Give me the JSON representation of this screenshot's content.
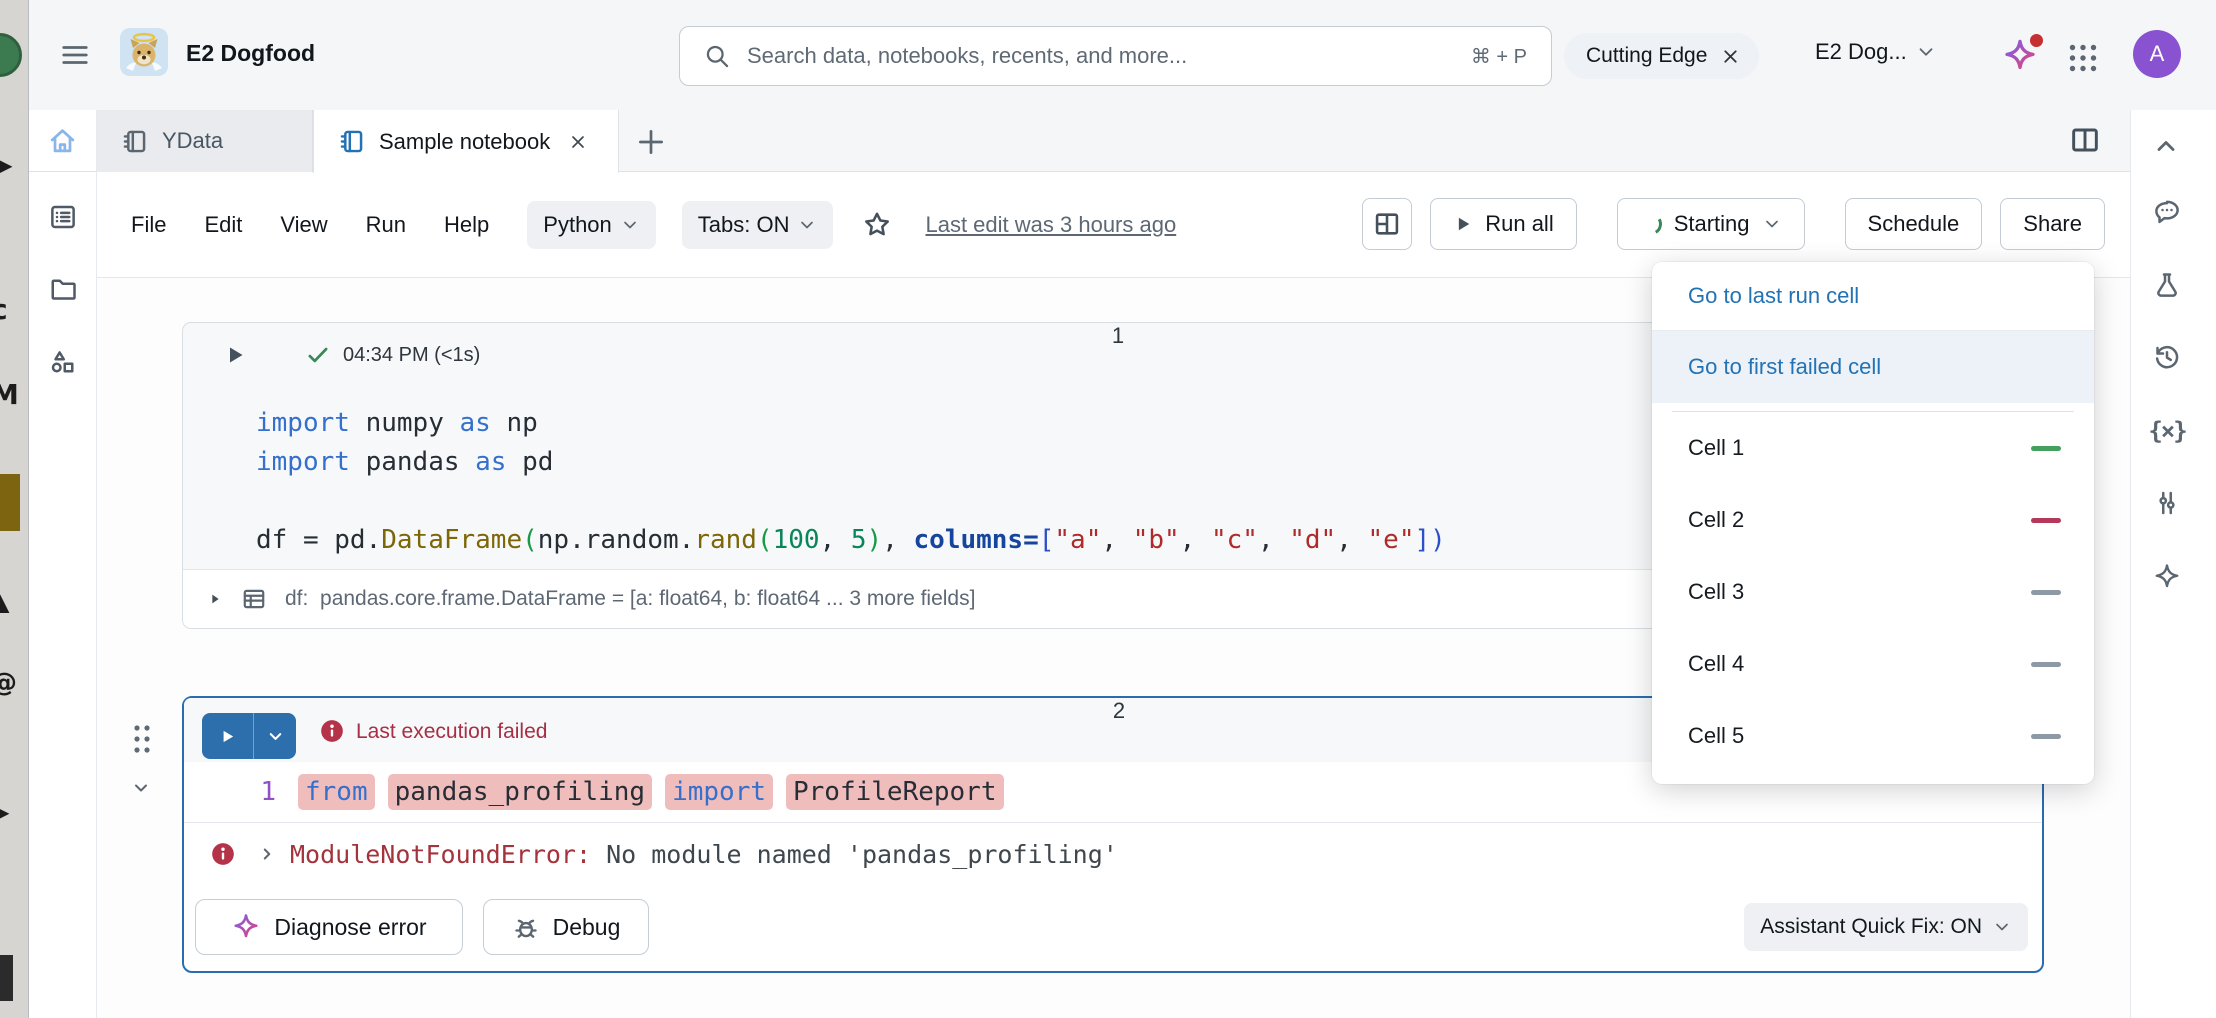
{
  "header": {
    "workspace_name": "E2 Dogfood",
    "search_placeholder": "Search data, notebooks, recents, and more...",
    "search_shortcut": "⌘ + P",
    "tag_chip": "Cutting Edge",
    "workspace_selector": "E2 Dog...",
    "avatar_letter": "A"
  },
  "tabs": {
    "tab1": "YData",
    "tab2": "Sample notebook"
  },
  "toolbar": {
    "menu_file": "File",
    "menu_edit": "Edit",
    "menu_view": "View",
    "menu_run": "Run",
    "menu_help": "Help",
    "language": "Python",
    "tabs_toggle": "Tabs: ON",
    "last_edit": "Last edit was 3 hours ago",
    "run_all": "Run all",
    "cluster_status": "Starting",
    "schedule": "Schedule",
    "share": "Share"
  },
  "cell1": {
    "number": "1",
    "run_info": "04:34 PM (<1s)",
    "code_lines": [
      [
        {
          "t": "import",
          "c": "kw"
        },
        {
          "t": " numpy ",
          "c": "p"
        },
        {
          "t": "as",
          "c": "kw"
        },
        {
          "t": " np",
          "c": "p"
        }
      ],
      [
        {
          "t": "import",
          "c": "kw"
        },
        {
          "t": " pandas ",
          "c": "p"
        },
        {
          "t": "as",
          "c": "kw"
        },
        {
          "t": " pd",
          "c": "p"
        }
      ],
      [],
      [
        {
          "t": "df = pd.",
          "c": "p"
        },
        {
          "t": "DataFrame",
          "c": "fn"
        },
        {
          "t": "(",
          "c": "brg"
        },
        {
          "t": "np.random.",
          "c": "p"
        },
        {
          "t": "rand",
          "c": "fn"
        },
        {
          "t": "(",
          "c": "brg"
        },
        {
          "t": "100",
          "c": "num"
        },
        {
          "t": ", ",
          "c": "p"
        },
        {
          "t": "5",
          "c": "num"
        },
        {
          "t": ")",
          "c": "brg"
        },
        {
          "t": ", ",
          "c": "p"
        },
        {
          "t": "columns",
          "c": "param"
        },
        {
          "t": "=",
          "c": "param"
        },
        {
          "t": "[",
          "c": "brb"
        },
        {
          "t": "\"a\"",
          "c": "str"
        },
        {
          "t": ", ",
          "c": "p"
        },
        {
          "t": "\"b\"",
          "c": "str"
        },
        {
          "t": ", ",
          "c": "p"
        },
        {
          "t": "\"c\"",
          "c": "str"
        },
        {
          "t": ", ",
          "c": "p"
        },
        {
          "t": "\"d\"",
          "c": "str"
        },
        {
          "t": ", ",
          "c": "p"
        },
        {
          "t": "\"e\"",
          "c": "str"
        },
        {
          "t": "]",
          "c": "brb"
        },
        {
          "t": ")",
          "c": "brb"
        }
      ]
    ],
    "result": "df:  pandas.core.frame.DataFrame = [a: float64, b: float64 ... 3 more fields]"
  },
  "cell2": {
    "number": "2",
    "status": "Last execution failed",
    "line_number": "1",
    "code_tokens": [
      {
        "t": "from",
        "c": "kw"
      },
      {
        "t": "pandas_profiling",
        "c": "p"
      },
      {
        "t": "import",
        "c": "kw"
      },
      {
        "t": "ProfileReport",
        "c": "p"
      }
    ],
    "error_prefix": "ModuleNotFoundError:",
    "error_message": " No module named 'pandas_profiling'",
    "diagnose": "Diagnose error",
    "debug": "Debug",
    "quick_fix": "Assistant Quick Fix: ON"
  },
  "run_menu": {
    "go_last": "Go to last run cell",
    "go_failed": "Go to first failed cell",
    "cells": [
      {
        "label": "Cell 1",
        "status": "success"
      },
      {
        "label": "Cell 2",
        "status": "failed"
      },
      {
        "label": "Cell 3",
        "status": "none"
      },
      {
        "label": "Cell 4",
        "status": "none"
      },
      {
        "label": "Cell 5",
        "status": "none"
      }
    ]
  },
  "colors": {
    "accent_blue": "#2272b4",
    "error_red": "#b43349",
    "success_green": "#43a05e",
    "neutral_dash": "#8d99a5"
  }
}
